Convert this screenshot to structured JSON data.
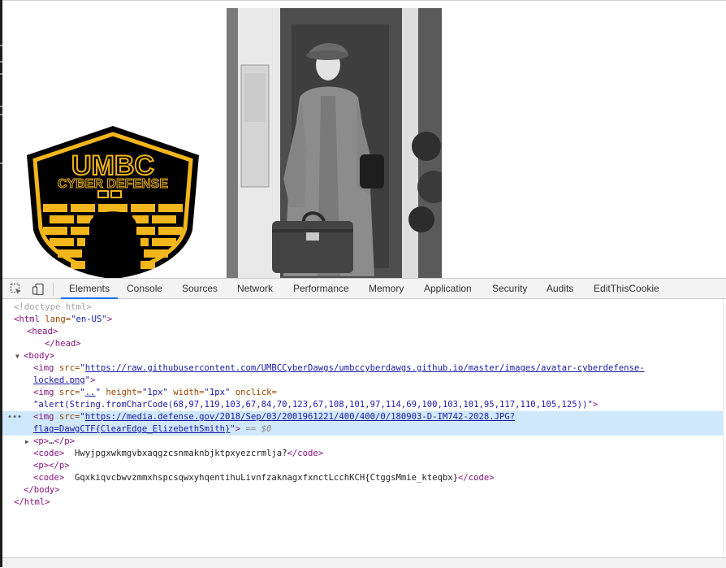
{
  "page": {
    "logo_text_top": "UMBC",
    "logo_text_bottom": "CYBER DEFENSE"
  },
  "devtools": {
    "tabs": [
      {
        "label": "Elements",
        "active": true
      },
      {
        "label": "Console"
      },
      {
        "label": "Sources"
      },
      {
        "label": "Network"
      },
      {
        "label": "Performance"
      },
      {
        "label": "Memory"
      },
      {
        "label": "Application"
      },
      {
        "label": "Security"
      },
      {
        "label": "Audits"
      },
      {
        "label": "EditThisCookie"
      }
    ],
    "dom": {
      "doctype": "<!doctype html>",
      "html_open": "<html",
      "html_lang_attr": " lang=",
      "html_lang_val": "\"en-US\"",
      "head_open": "<head>",
      "head_close": "</head>",
      "body_open": "<body>",
      "img1_src_url": "https://raw.githubusercontent.com/UMBCCyberDawgs/umbccyberdawgs.github.io/master/images/avatar-cyberdefense-",
      "img1_src_url2": "locked.png",
      "img2_src": "..",
      "img2_height": "\"1px\"",
      "img2_width": "\"1px\"",
      "img2_onclick": "\"alert(String.fromCharCode(68,97,119,103,67,84,70,123,67,108,101,97,114,69,100,103,101,95,117,110,105,125))\"",
      "img3_src_url": "https://media.defense.gov/2018/Sep/03/2001961221/400/400/0/180903-D-IM742-2028.JPG?",
      "img3_src_url2": "flag=DawgCTF{ClearEdge_ElizebethSmith}",
      "selected_marker": "== $0",
      "p_collapsed": "…",
      "code1_text": "Hwyjpgxwkmgvbxaqgzcsnmaknbjktpxyezcrmlja?",
      "code2_text": "GqxkiqvcbwvzmmxhspcsqwxyhqentihuLivnfzaknagxfxnctLcchKCH{CtggsMmie_kteqbx}",
      "body_close": "</body>",
      "html_close": "</html>"
    }
  },
  "colors": {
    "tag": "#881280",
    "attr": "#994500",
    "value": "#1a1aa6",
    "selection": "#cfe8fc",
    "logo_gold": "#f2b51b"
  }
}
